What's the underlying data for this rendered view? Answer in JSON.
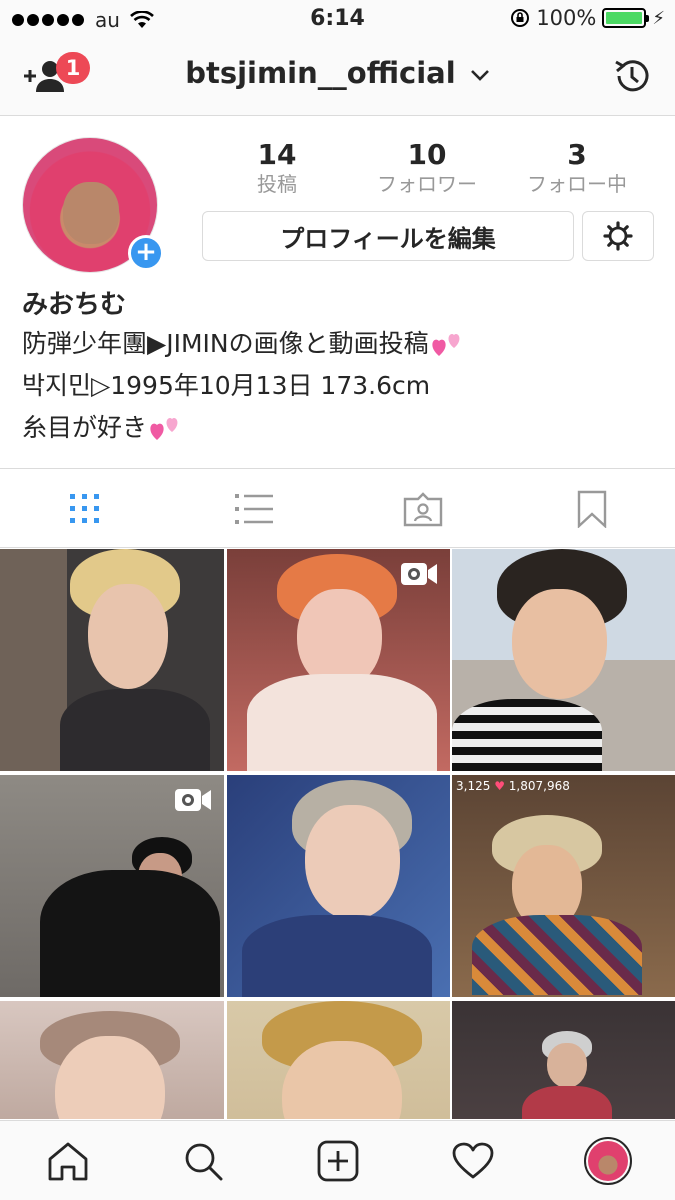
{
  "status_bar": {
    "carrier": "au",
    "time": "6:14",
    "battery_text": "100%",
    "battery_level": 1.0,
    "battery_color": "#4cd964"
  },
  "header": {
    "username": "btsjimin__official",
    "notification_count": "1",
    "badge_color": "#ed4956",
    "icons": [
      "add-user-icon",
      "chevron-down-icon",
      "history-icon"
    ]
  },
  "profile": {
    "stats": [
      {
        "value": "14",
        "label": "投稿"
      },
      {
        "value": "10",
        "label": "フォロワー"
      },
      {
        "value": "3",
        "label": "フォロー中"
      }
    ],
    "edit_label": "プロフィールを編集",
    "display_name": "みおちむ",
    "bio_lines": [
      "防弾少年團▶JIMINの画像と動画投稿",
      "박지민▷1995年10月13日 173.6cm",
      "糸目が好き"
    ],
    "accent_color": "#3897f0"
  },
  "tabs": [
    {
      "icon": "grid-icon",
      "active": true
    },
    {
      "icon": "list-icon",
      "active": false
    },
    {
      "icon": "tagged-icon",
      "active": false
    },
    {
      "icon": "bookmark-icon",
      "active": false
    }
  ],
  "grid": {
    "live_viewers": "3,125",
    "live_hearts": "1,807,968"
  },
  "bottom_nav": [
    "home-icon",
    "search-icon",
    "add-post-icon",
    "heart-icon",
    "profile-avatar"
  ]
}
